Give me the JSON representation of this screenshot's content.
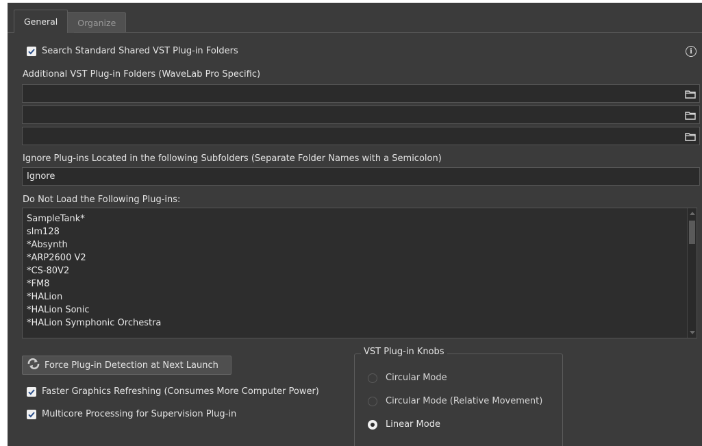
{
  "tabs": [
    {
      "label": "General",
      "active": true
    },
    {
      "label": "Organize",
      "active": false
    }
  ],
  "search_standard": {
    "label": "Search Standard Shared VST Plug-in Folders",
    "checked": true
  },
  "info_icon": "info-icon",
  "additional_folders": {
    "label": "Additional VST Plug-in Folders (WaveLab Pro Specific)",
    "fields": [
      "",
      "",
      ""
    ]
  },
  "ignore_subfolders": {
    "label": "Ignore Plug-ins Located in the following Subfolders (Separate Folder Names with a Semicolon)",
    "value": "Ignore"
  },
  "do_not_load": {
    "label": "Do Not Load the Following Plug-ins:",
    "items": [
      "SampleTank*",
      "slm128",
      "*Absynth",
      "*ARP2600 V2",
      "*CS-80V2",
      "*FM8",
      "*HALion",
      "*HALion Sonic",
      "*HALion Symphonic Orchestra"
    ]
  },
  "force_detection": {
    "label": "Force Plug-in Detection at Next Launch",
    "icon": "refresh-icon"
  },
  "faster_graphics": {
    "label": "Faster Graphics Refreshing (Consumes More Computer Power)",
    "checked": true
  },
  "multicore": {
    "label": "Multicore Processing for Supervision Plug-in",
    "checked": true
  },
  "knobs": {
    "title": "VST Plug-in Knobs",
    "options": [
      {
        "label": "Circular Mode",
        "selected": false
      },
      {
        "label": "Circular Mode (Relative Movement)",
        "selected": false
      },
      {
        "label": "Linear Mode",
        "selected": true
      }
    ]
  },
  "colors": {
    "background": "#3b3b3b",
    "field": "#2b2b2b",
    "text": "#e4e4e4"
  }
}
